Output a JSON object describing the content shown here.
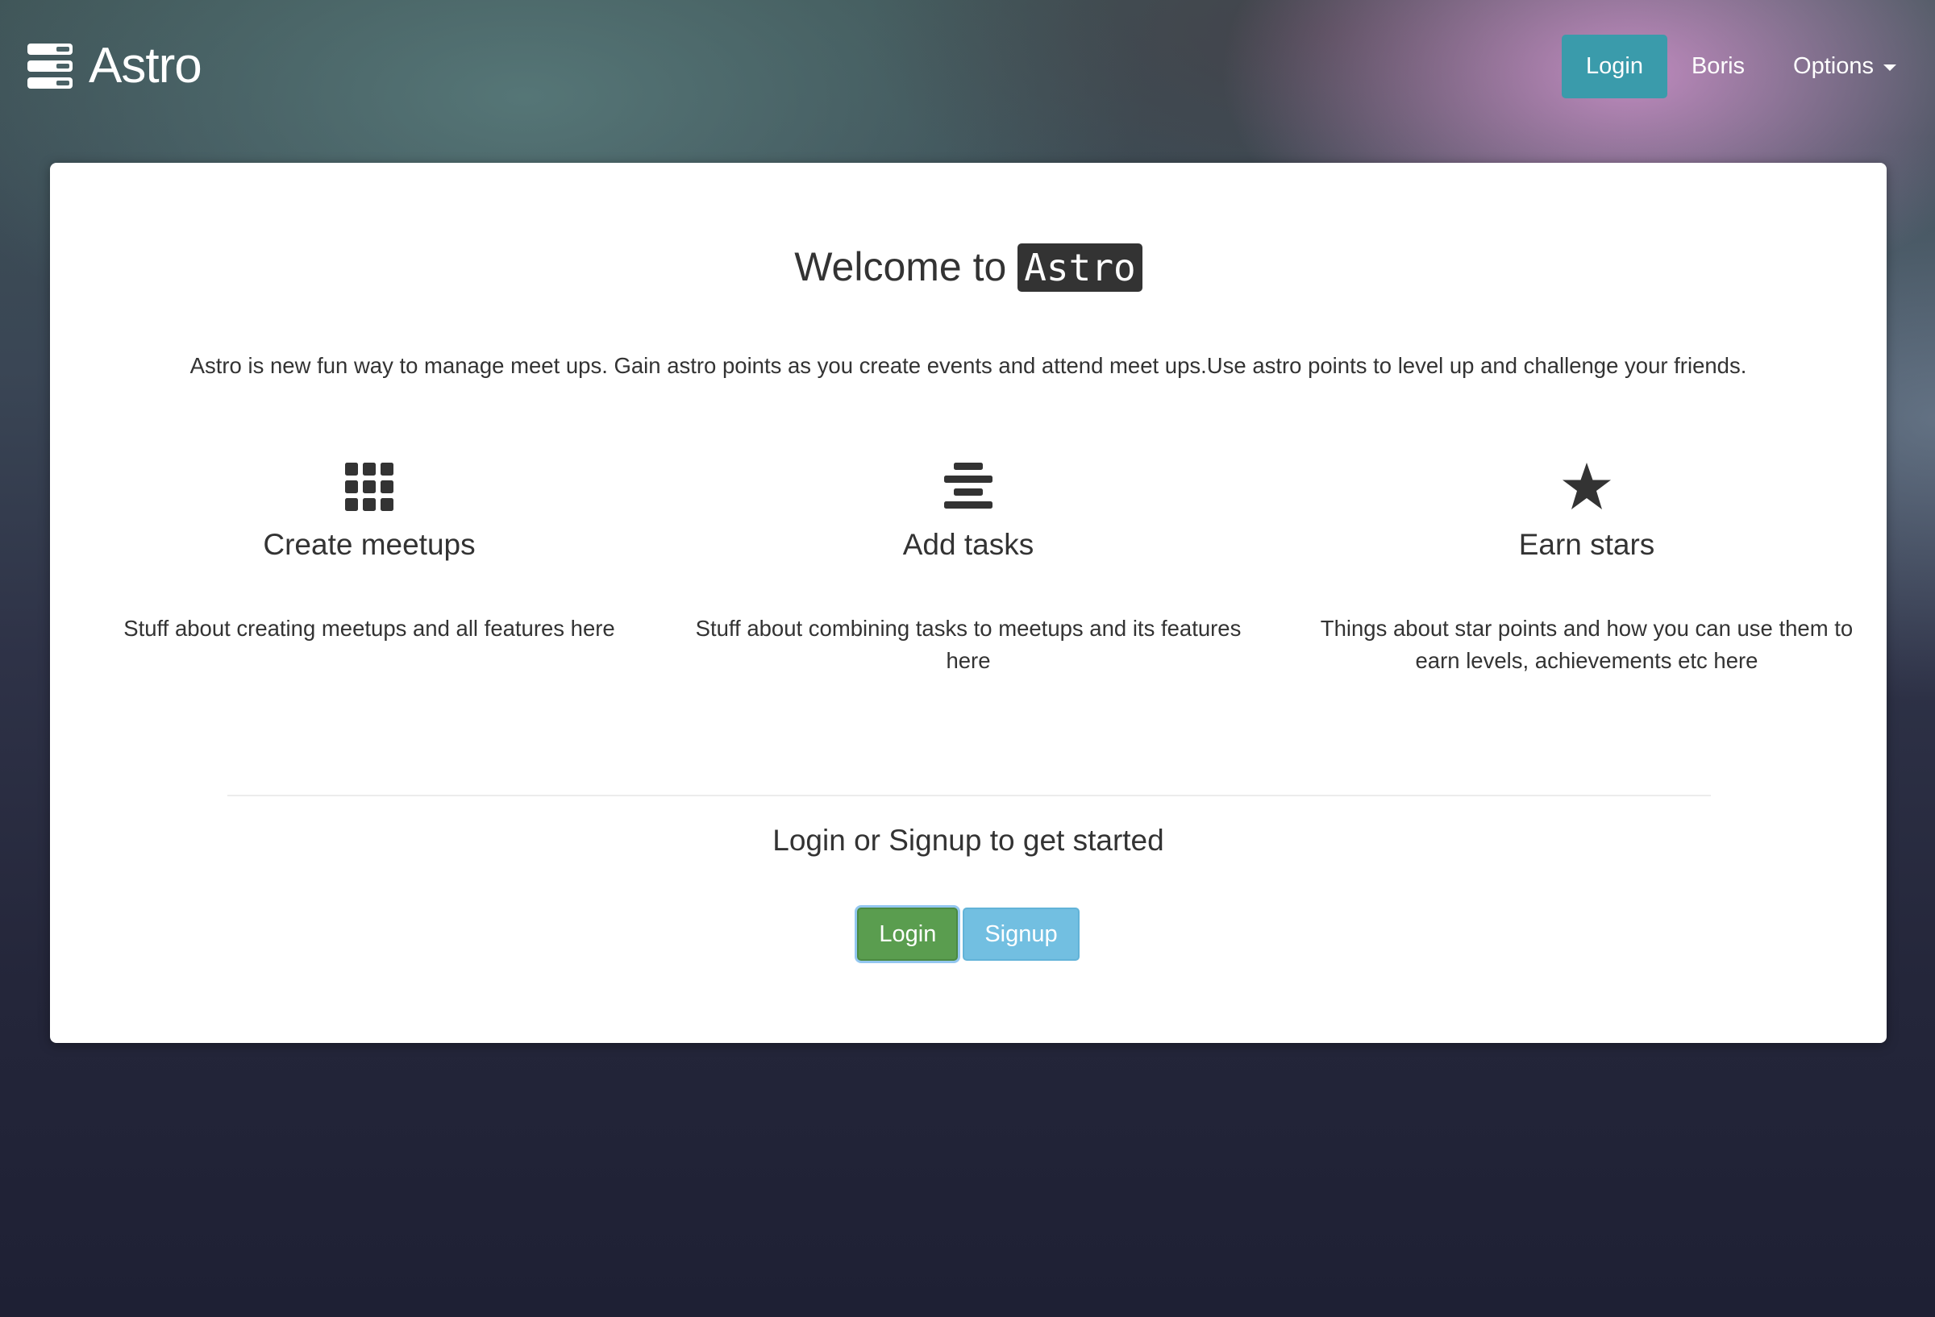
{
  "navbar": {
    "brand": "Astro",
    "brand_icon": "stacked-bars-icon",
    "login_label": "Login",
    "user_label": "Boris",
    "options_label": "Options"
  },
  "main": {
    "welcome_prefix": "Welcome to",
    "welcome_code": "Astro",
    "intro": "Astro is new fun way to manage meet ups. Gain astro points as you create events and attend meet ups.Use astro points to level up and challenge your friends.",
    "features": [
      {
        "icon": "grid-icon",
        "title": "Create meetups",
        "description": "Stuff about creating meetups and all features here"
      },
      {
        "icon": "align-center-icon",
        "title": "Add tasks",
        "description": "Stuff about combining tasks to meetups and its features here"
      },
      {
        "icon": "star-icon",
        "title": "Earn stars",
        "description": "Things about star points and how you can use them to earn levels, achievements etc here"
      }
    ],
    "cta": {
      "title": "Login or Signup to get started",
      "login_label": "Login",
      "signup_label": "Signup"
    }
  },
  "colors": {
    "nav_login_bg": "#3a9bab",
    "login_button_bg": "#5a9d4f",
    "signup_button_bg": "#72bfe1",
    "text": "#333333"
  }
}
